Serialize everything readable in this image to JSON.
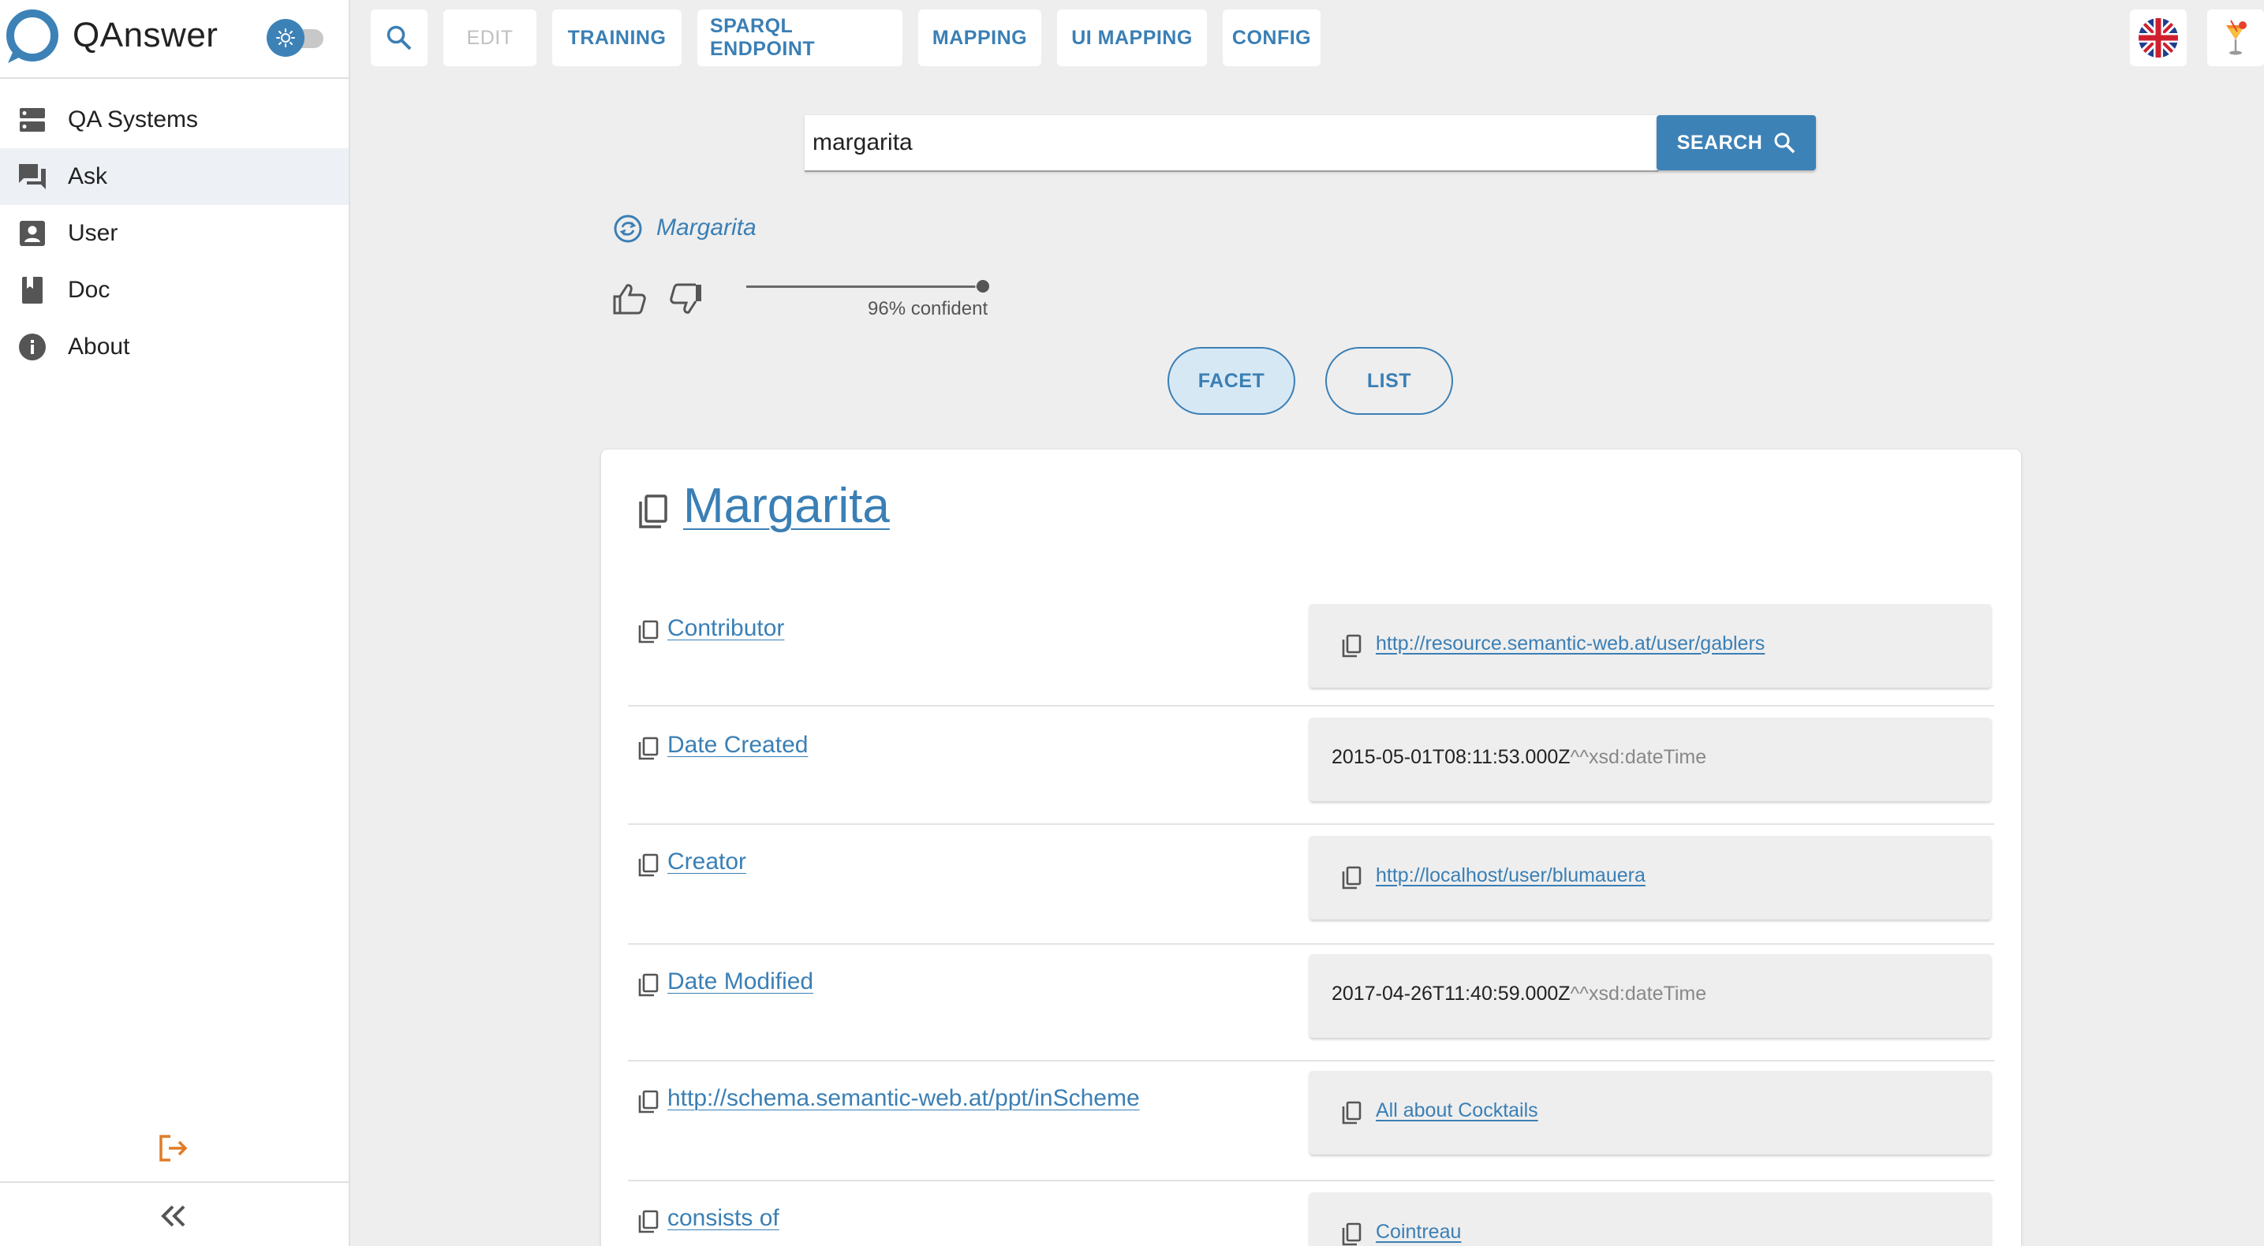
{
  "app": {
    "name": "QAnswer"
  },
  "sidebar": {
    "items": [
      {
        "label": "QA Systems",
        "icon": "dns-icon"
      },
      {
        "label": "Ask",
        "icon": "forum-icon",
        "active": true
      },
      {
        "label": "User",
        "icon": "account-box-icon"
      },
      {
        "label": "Doc",
        "icon": "book-icon"
      },
      {
        "label": "About",
        "icon": "info-icon"
      }
    ]
  },
  "toolbar": {
    "edit": "EDIT",
    "training": "TRAINING",
    "sparql": "SPARQL ENDPOINT",
    "mapping": "MAPPING",
    "ui_mapping": "UI MAPPING",
    "config": "CONFIG"
  },
  "search": {
    "value": "margarita",
    "button_label": "SEARCH"
  },
  "answer": {
    "title": "Margarita",
    "confidence_label": "96% confident",
    "confidence": 0.96
  },
  "views": {
    "facet": "FACET",
    "list": "LIST"
  },
  "card": {
    "title": "Margarita",
    "rows": [
      {
        "label": "Contributor",
        "value": "http://resource.semantic-web.at/user/gablers",
        "kind": "link"
      },
      {
        "label": "Date Created",
        "value": "2015-05-01T08:11:53.000Z",
        "type_suffix": "^^xsd:dateTime",
        "kind": "literal"
      },
      {
        "label": "Creator",
        "value": "http://localhost/user/blumauera",
        "kind": "link"
      },
      {
        "label": "Date Modified",
        "value": "2017-04-26T11:40:59.000Z",
        "type_suffix": "^^xsd:dateTime",
        "kind": "literal"
      },
      {
        "label": "http://schema.semantic-web.at/ppt/inScheme",
        "value": "All about Cocktails",
        "kind": "link"
      },
      {
        "label": "consists of",
        "value": "Cointreau",
        "kind": "link"
      }
    ]
  },
  "colors": {
    "accent": "#3d82b7",
    "logout": "#e07b26"
  }
}
